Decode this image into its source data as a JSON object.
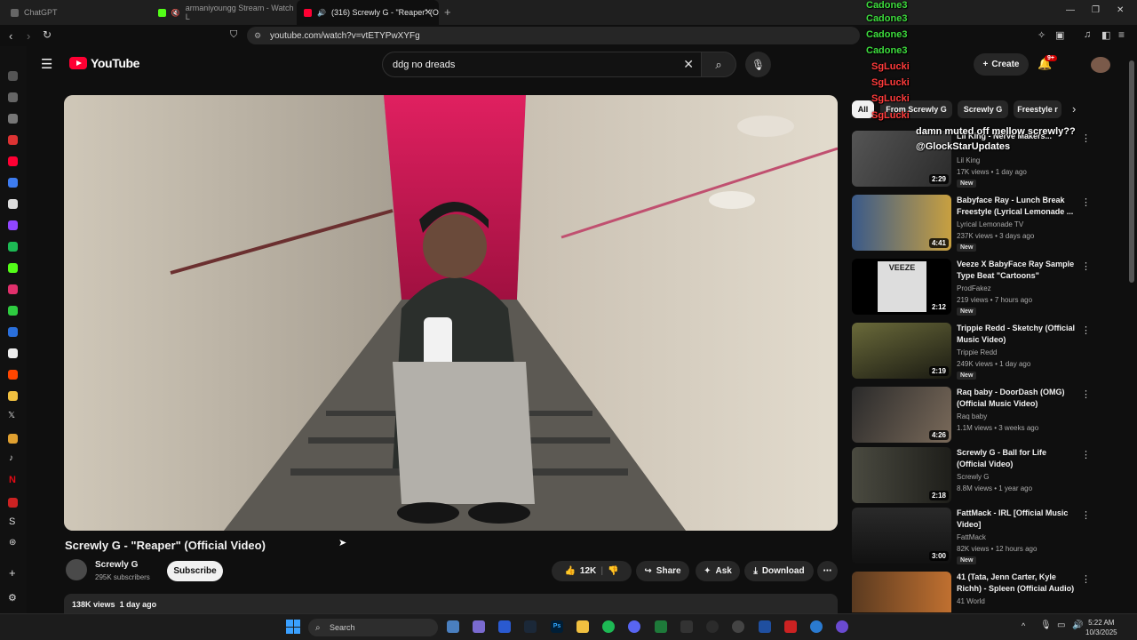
{
  "browser": {
    "tabs": [
      {
        "label": "ChatGPT"
      },
      {
        "label": "armaniyoungg Stream - Watch L"
      },
      {
        "label": "(316) Screwly G - \"Reaper\" (O"
      }
    ],
    "url": "youtube.com/watch?v=vtETYPwXYFg"
  },
  "youtube": {
    "logo": "YouTube",
    "search_query": "ddg no dreads",
    "create_label": "Create",
    "notif_count": "9+"
  },
  "video": {
    "title": "Screwly G - \"Reaper\" (Official Video)",
    "channel": "Screwly G",
    "subscribers": "295K subscribers",
    "subscribe_label": "Subscribe",
    "likes": "12K",
    "share_label": "Share",
    "ask_label": "Ask",
    "download_label": "Download",
    "views": "138K views",
    "age": "1 day ago"
  },
  "chips": [
    "All",
    "From Screwly G",
    "Screwly G",
    "Freestyle r"
  ],
  "recommended": [
    {
      "title": "Lil King - Nerve Makers...",
      "channel": "Lil King",
      "meta": "17K views • 1 day ago",
      "duration": "2:29",
      "new": "New"
    },
    {
      "title": "Babyface Ray - Lunch Break Freestyle (Lyrical Lemonade ...",
      "channel": "Lyrical Lemonade TV",
      "meta": "237K views • 3 days ago",
      "duration": "4:41",
      "new": "New"
    },
    {
      "title": "Veeze X BabyFace Ray Sample Type Beat \"Cartoons\"",
      "channel": "ProdFakez",
      "meta": "219 views • 7 hours ago",
      "duration": "2:12",
      "new": "New",
      "thumb_text": "VEEZE"
    },
    {
      "title": "Trippie Redd - Sketchy (Official Music Video)",
      "channel": "Trippie Redd",
      "meta": "249K views • 1 day ago",
      "duration": "2:19",
      "new": "New"
    },
    {
      "title": "Raq baby - DoorDash (OMG) (Official Music Video)",
      "channel": "Raq baby",
      "meta": "1.1M views • 3 weeks ago",
      "duration": "4:26",
      "new": ""
    },
    {
      "title": "Screwly G - Ball for Life (Official Video)",
      "channel": "Screwly G",
      "meta": "8.8M views • 1 year ago",
      "duration": "2:18",
      "new": ""
    },
    {
      "title": "FattMack - IRL [Official Music Video]",
      "channel": "FattMack",
      "meta": "82K views • 12 hours ago",
      "duration": "3:00",
      "new": "New"
    },
    {
      "title": "41 (Tata, Jenn Carter, Kyle Richh) - Spleen (Official Audio)",
      "channel": "41 World",
      "meta": "",
      "duration": "",
      "new": ""
    }
  ],
  "chat_overlay": {
    "names": [
      "Cadone3",
      "Cadone3",
      "Cadone3",
      "Cadone3",
      "SgLucki",
      "SgLucki",
      "SgLucki",
      "SgLucki"
    ],
    "message1": "damn muted off mellow screwly??",
    "message2": "@GlockStarUpdates"
  },
  "taskbar": {
    "search_label": "Search",
    "time": "5:22 AM",
    "date": "10/3/2025"
  }
}
